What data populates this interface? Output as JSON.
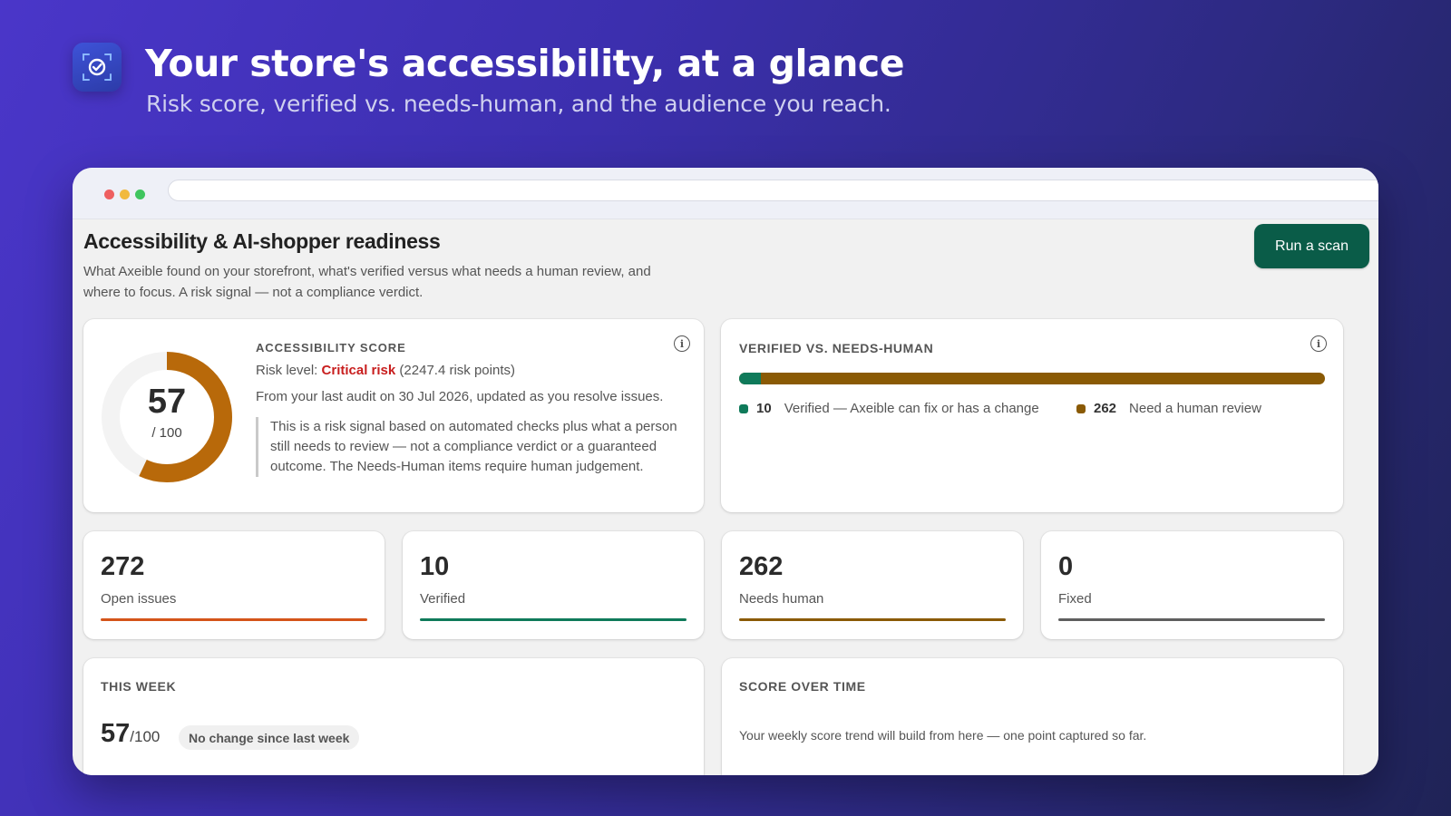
{
  "hero": {
    "title": "Your store's accessibility, at a glance",
    "subtitle": "Risk score, verified vs. needs-human, and the audience you reach.",
    "logo_icon": "scan-check-icon"
  },
  "page": {
    "title": "Accessibility & AI-shopper readiness",
    "description": "What Axeible found on your storefront, what's verified versus what needs a human review, and where to focus. A risk signal — not a compliance verdict.",
    "scan_button": "Run a scan"
  },
  "score_card": {
    "label": "ACCESSIBILITY SCORE",
    "score": "57",
    "score_fraction": 0.57,
    "denominator": "/ 100",
    "risk_prefix": "Risk level: ",
    "risk_level": "Critical risk",
    "risk_points": " (2247.4 risk points)",
    "audit_text": "From your last audit on 30 Jul 2026, updated as you resolve issues.",
    "note": "This is a risk signal based on automated checks plus what a person still needs to review — not a compliance verdict or a guaranteed outcome. The Needs-Human items require human judgement.",
    "info_icon": "info-icon"
  },
  "verified_card": {
    "label": "VERIFIED VS. NEEDS-HUMAN",
    "verified_count": 10,
    "needs_human_count": 262,
    "verified_num": "10",
    "verified_label": "Verified — Axeible can fix or has a change",
    "needs_num": "262",
    "needs_label": "Need a human review"
  },
  "stats": [
    {
      "value": "272",
      "label": "Open issues",
      "color": "#d4541a"
    },
    {
      "value": "10",
      "label": "Verified",
      "color": "#0f7a5a"
    },
    {
      "value": "262",
      "label": "Needs human",
      "color": "#8a5a05"
    },
    {
      "value": "0",
      "label": "Fixed",
      "color": "#5f5f5f"
    }
  ],
  "this_week": {
    "label": "THIS WEEK",
    "score": "57",
    "denominator": "/100",
    "badge": "No change since last week"
  },
  "score_over_time": {
    "label": "SCORE OVER TIME",
    "text": "Your weekly score trend will build from here — one point captured so far."
  },
  "colors": {
    "accent_button": "#0a5c48",
    "donut": "#b8690a",
    "critical": "#c81e1e"
  }
}
